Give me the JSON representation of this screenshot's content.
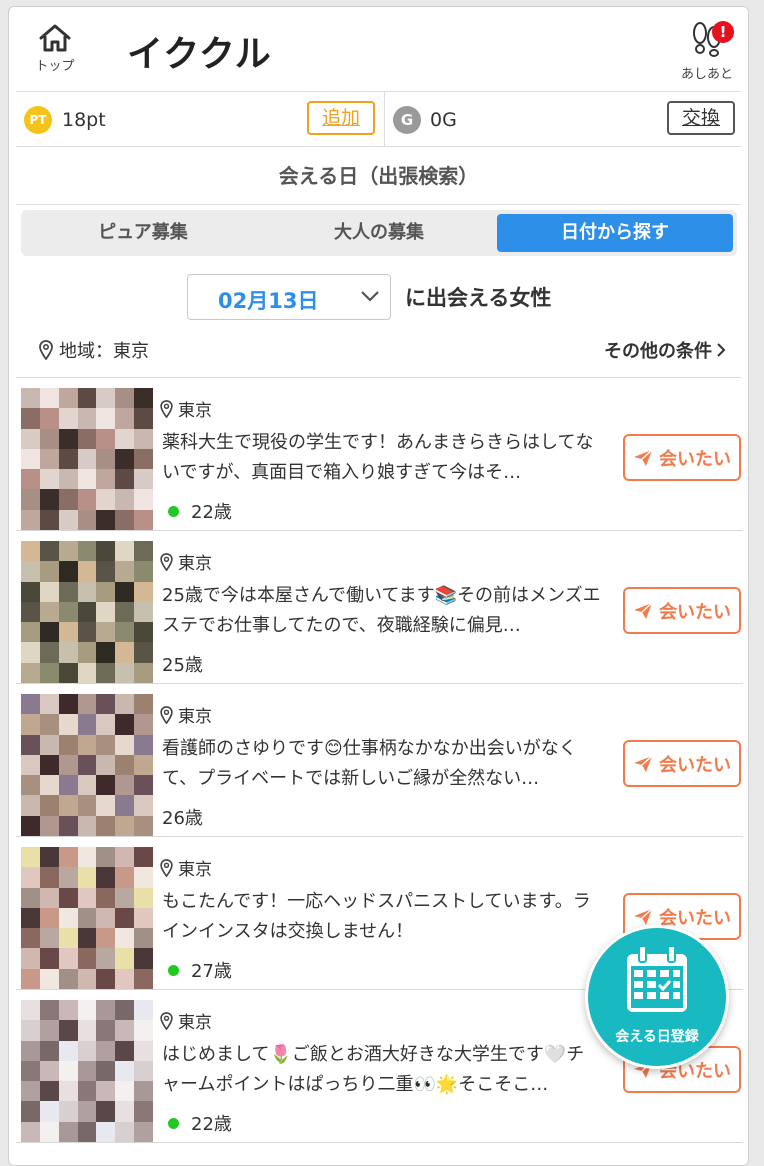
{
  "header": {
    "title": "イククル",
    "home_label": "トップ",
    "ashiato_label": "あしあと",
    "ashiato_badge": "!"
  },
  "points": {
    "pt_icon": "PT",
    "pt_value": "18pt",
    "add_label": "追加",
    "g_icon": "G",
    "g_value": "0G",
    "exchange_label": "交換"
  },
  "page_title": "会える日（出張検索）",
  "tabs": [
    {
      "label": "ピュア募集",
      "active": false
    },
    {
      "label": "大人の募集",
      "active": false
    },
    {
      "label": "日付から探す",
      "active": true
    }
  ],
  "date_filter": {
    "selected": "02月13日",
    "suffix": "に出会える女性"
  },
  "area": {
    "text": "地域：東京"
  },
  "other_conditions": "その他の条件",
  "items": [
    {
      "location": "東京",
      "message": "薬科大生で現役の学生です！あんまきらきらはしてないですが、真面目で箱入り娘すぎて今はそ…",
      "age": "22歳",
      "online": true,
      "button": "会いたい"
    },
    {
      "location": "東京",
      "message": "25歳で今は本屋さんで働いてます📚その前はメンズエステでお仕事してたので、夜職経験に偏見…",
      "age": "25歳",
      "online": false,
      "button": "会いたい"
    },
    {
      "location": "東京",
      "message": "看護師のさゆりです😊仕事柄なかなか出会いがなくて、プライベートでは新しいご縁が全然ない…",
      "age": "26歳",
      "online": false,
      "button": "会いたい"
    },
    {
      "location": "東京",
      "message": "もこたんです！一応ヘッドスパニストしています。ラインインスタは交換しません！",
      "age": "27歳",
      "online": true,
      "button": "会いたい"
    },
    {
      "location": "東京",
      "message": "はじめまして🌷ご飯とお酒大好きな大学生です🤍チャームポイントはぱっちり二重👀🌟そこそこ…",
      "age": "22歳",
      "online": true,
      "button": "会いたい"
    }
  ],
  "fab": {
    "label": "会える日登録"
  },
  "colors": {
    "accent_blue": "#2d8fe8",
    "accent_orange": "#f37b4b",
    "point_yellow": "#f6c31b",
    "fab_teal": "#18b9c1",
    "online_green": "#22c922"
  }
}
